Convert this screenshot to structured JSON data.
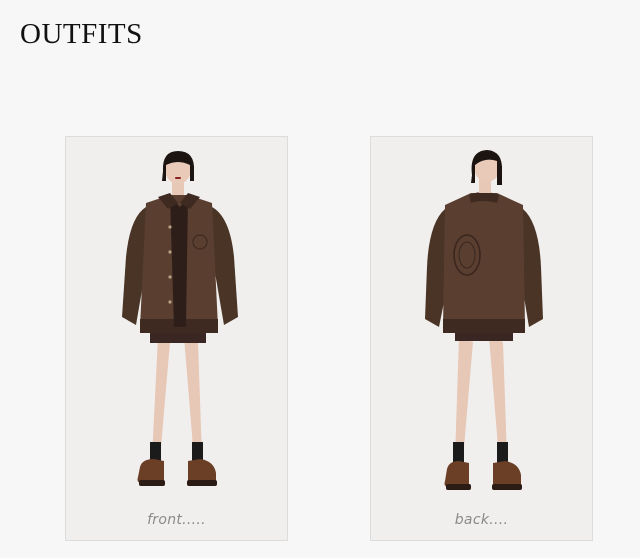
{
  "header": {
    "title": "OUTFITS"
  },
  "outfits": [
    {
      "caption": "front.....",
      "view": "front"
    },
    {
      "caption": "back....",
      "view": "back"
    }
  ],
  "colors": {
    "background": "#f7f7f7",
    "panel": "#f1efee",
    "jacket": "#5a3f31",
    "jacket_dark": "#3e2a20",
    "sleeve": "#4a3426",
    "skin": "#e9c9b8",
    "hair": "#1c1410",
    "shoe": "#6b3e26"
  }
}
